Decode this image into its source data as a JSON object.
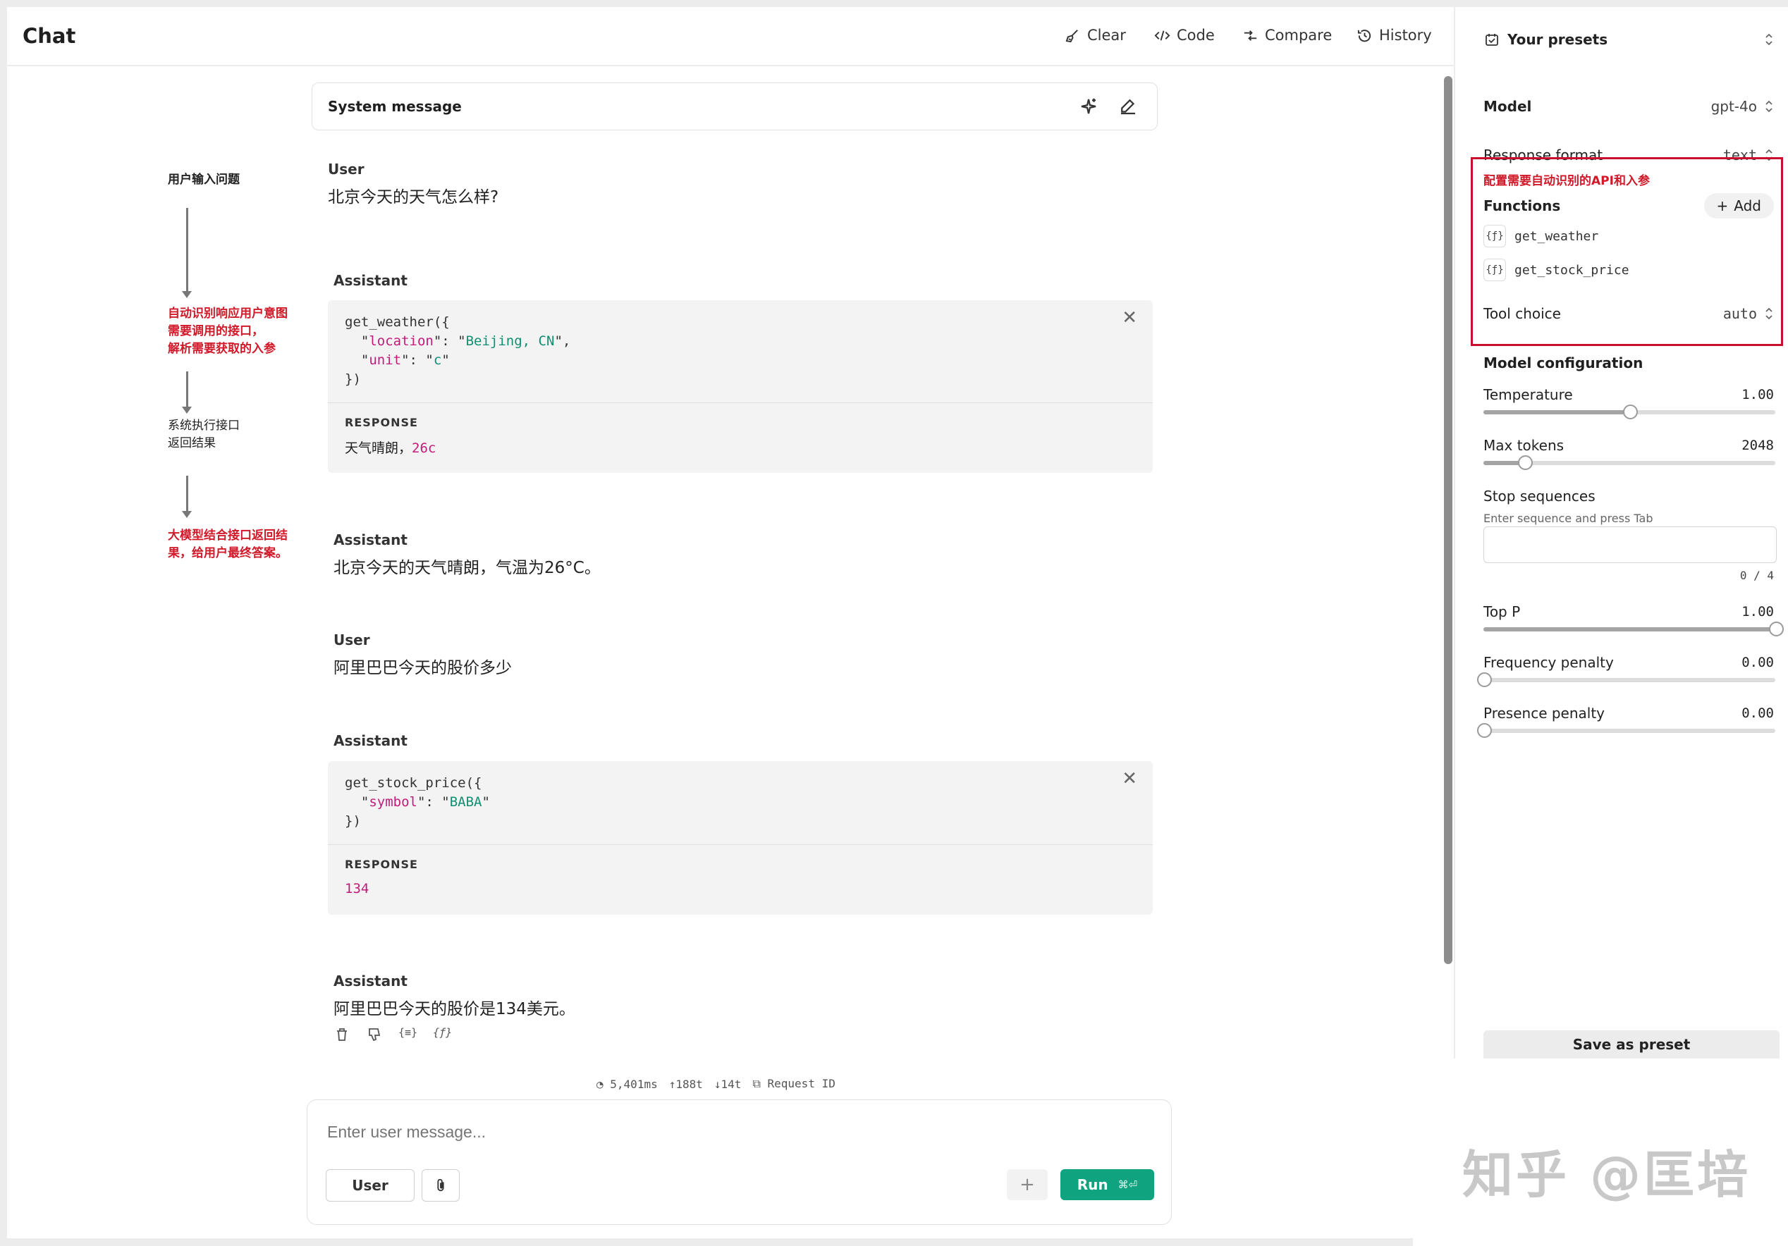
{
  "header": {
    "title": "Chat",
    "actions": [
      {
        "id": "clear",
        "label": "Clear"
      },
      {
        "id": "code",
        "label": "Code"
      },
      {
        "id": "compare",
        "label": "Compare"
      },
      {
        "id": "history",
        "label": "History"
      }
    ]
  },
  "presets": {
    "label": "Your presets"
  },
  "settings": {
    "model_label": "Model",
    "model_value": "gpt-4o",
    "response_format_label": "Response format",
    "response_format_value": "text",
    "functions_label": "Functions",
    "add_label": "Add",
    "functions": [
      "get_weather",
      "get_stock_price"
    ],
    "tool_choice_label": "Tool choice",
    "tool_choice_value": "auto",
    "model_config_label": "Model configuration",
    "temperature": {
      "label": "Temperature",
      "value": "1.00",
      "fraction": 0.5
    },
    "max_tokens": {
      "label": "Max tokens",
      "value": "2048",
      "fraction": 0.14
    },
    "stop_sequences": {
      "label": "Stop sequences",
      "hint": "Enter sequence and press Tab",
      "count": "0 / 4"
    },
    "top_p": {
      "label": "Top P",
      "value": "1.00",
      "fraction": 1.0
    },
    "frequency_penalty": {
      "label": "Frequency penalty",
      "value": "0.00",
      "fraction": 0.0
    },
    "presence_penalty": {
      "label": "Presence penalty",
      "value": "0.00",
      "fraction": 0.0
    },
    "save_preset_label": "Save as preset"
  },
  "annotations": {
    "right": "配置需要自动识别的API和入参",
    "left": [
      "用户输入问题",
      "自动识别响应用户意图\n需要调用的接口，\n解析需要获取的入参",
      "系统执行接口\n返回结果",
      "大模型结合接口返回结\n果，给用户最终答案。"
    ]
  },
  "chat": {
    "system_label": "System message",
    "msg1": {
      "role": "User",
      "text": "北京今天的天气怎么样?"
    },
    "call1": {
      "role": "Assistant",
      "fn": "get_weather",
      "args": [
        {
          "key": "location",
          "value": "Beijing, CN"
        },
        {
          "key": "unit",
          "value": "c"
        }
      ],
      "response_label": "RESPONSE",
      "response_text": "天气晴朗，",
      "response_num": "26c"
    },
    "msg2": {
      "role": "Assistant",
      "text": "北京今天的天气晴朗，气温为26°C。"
    },
    "msg3": {
      "role": "User",
      "text": "阿里巴巴今天的股价多少"
    },
    "call2": {
      "role": "Assistant",
      "fn": "get_stock_price",
      "args": [
        {
          "key": "symbol",
          "value": "BABA"
        }
      ],
      "response_label": "RESPONSE",
      "response_num": "134"
    },
    "msg4": {
      "role": "Assistant",
      "text": "阿里巴巴今天的股价是134美元。"
    }
  },
  "stats": {
    "latency": "5,401ms",
    "tokens_up": "188t",
    "tokens_down": "14t",
    "request_id_label": "Request ID"
  },
  "composer": {
    "placeholder": "Enter user message...",
    "role_button": "User",
    "run_label": "Run",
    "run_shortcut": "⌘⏎"
  },
  "watermark": "知乎 @匡培",
  "colors": {
    "run_button": "#10a37f",
    "annotation_red": "#d01a2a",
    "json_key": "#c21b7a",
    "json_string": "#0f8f72"
  }
}
